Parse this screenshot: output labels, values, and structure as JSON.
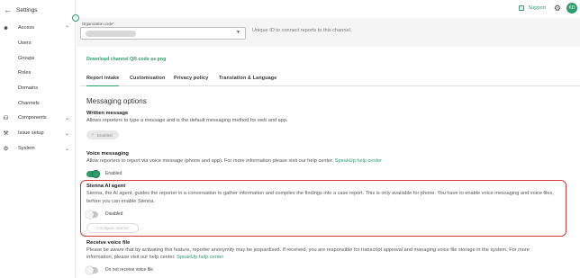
{
  "sidebar": {
    "title": "Settings",
    "groups": [
      {
        "label": "Access",
        "icon": "people-icon"
      },
      {
        "label": "Components",
        "icon": "database-icon"
      },
      {
        "label": "Issue setup",
        "icon": "wrench-icon"
      },
      {
        "label": "System",
        "icon": "gear-icon"
      }
    ],
    "access_items": [
      "Users",
      "Groups",
      "Roles",
      "Domains",
      "Channels"
    ]
  },
  "topbar": {
    "support_label": "Support",
    "avatar_initials": "KD"
  },
  "org": {
    "label": "Organization code*",
    "help": "Unique ID to connect reports to this channel."
  },
  "download_link": "Download channel QR code as png",
  "tabs": [
    "Report intake",
    "Customisation",
    "Privacy policy",
    "Translation & Language"
  ],
  "section_title": "Messaging options",
  "written": {
    "title": "Written message",
    "desc": "Allows reporters to type a message and is the default messaging method for web and app.",
    "chip": "Enabled"
  },
  "voice": {
    "title": "Voice messaging",
    "desc": "Allow reporters to report via voice message (phone and app). For more information please visit our help center.",
    "link": "SpeakUp help center",
    "toggle_label": "Enabled",
    "enabled": true
  },
  "sienna": {
    "title": "Sienna AI agent",
    "desc": "Sienna, the AI agent, guides the reporter in a conversation to gather information and compiles the findings into a case report. This is only available for phone. You have to enable voice messaging and voice files, before you can enable Sienna.",
    "toggle_label": "Disabled",
    "enabled": false,
    "button": "Configure Sienna"
  },
  "voice_file": {
    "title": "Receive voice file",
    "desc_line1": "Please be aware that by activating this feature, reporter anonymity may be jeopardised. If received, you are responsible for transcript approval and managing voice file storage in the system. For more",
    "desc_line2": "information, please visit our help center.",
    "link": "SpeakUp help center",
    "toggle_label": "Do not receive voice file",
    "enabled": false
  },
  "colors": {
    "accent": "#2e9c6c",
    "highlight": "#d33a3a"
  }
}
